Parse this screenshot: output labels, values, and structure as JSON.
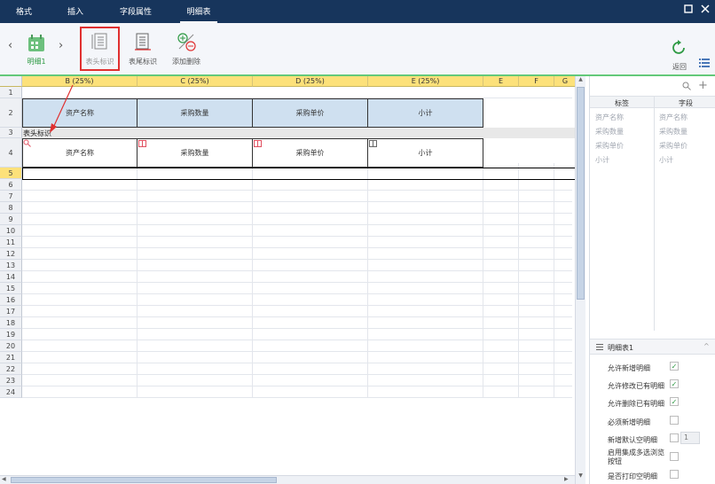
{
  "menu": {
    "tabs": [
      {
        "label": "格式",
        "active": false
      },
      {
        "label": "插入",
        "active": false
      },
      {
        "label": "字段属性",
        "active": false
      },
      {
        "label": "明细表",
        "active": true
      }
    ]
  },
  "ribbon": {
    "detail_item": "明细1",
    "buttons": [
      {
        "label": "表头标识",
        "highlighted": true
      },
      {
        "label": "表尾标识",
        "highlighted": false
      },
      {
        "label": "添加删除",
        "highlighted": false
      }
    ],
    "back_label": "返回"
  },
  "sheet": {
    "columns": [
      "B (25%)",
      "C (25%)",
      "D (25%)",
      "E (25%)",
      "E",
      "F",
      "G"
    ],
    "rows": [
      "1",
      "2",
      "3",
      "4",
      "5",
      "6",
      "7",
      "8",
      "9",
      "10",
      "11",
      "12",
      "13",
      "14",
      "15",
      "16",
      "17",
      "18",
      "19",
      "20",
      "21",
      "22",
      "23",
      "24"
    ],
    "header_cells": [
      "资产名称",
      "采购数量",
      "采购单价",
      "小计"
    ],
    "band_label": "表头标识",
    "detail_cells": [
      "资产名称",
      "采购数量",
      "采购单价",
      "小计"
    ]
  },
  "fields_panel": {
    "col_label": "标签",
    "col_field": "字段",
    "rows": [
      {
        "label": "资产名称",
        "field": "资产名称"
      },
      {
        "label": "采购数量",
        "field": "采购数量"
      },
      {
        "label": "采购单价",
        "field": "采购单价"
      },
      {
        "label": "小计",
        "field": "小计"
      }
    ]
  },
  "detail_props": {
    "title": "明细表1",
    "options": [
      {
        "label": "允许新增明细",
        "checked": true
      },
      {
        "label": "允许修改已有明细",
        "checked": true
      },
      {
        "label": "允许删除已有明细",
        "checked": true
      },
      {
        "label": "必须新增明细",
        "checked": false
      },
      {
        "label": "新增默认空明细",
        "checked": false,
        "value": "1"
      },
      {
        "label": "启用集成多选浏览按钮",
        "checked": false
      },
      {
        "label": "是否打印空明细",
        "checked": false
      }
    ]
  },
  "colors": {
    "topbar": "#17355c",
    "col_header": "#fce17a",
    "header_cell": "#cfe0f0",
    "accent_green": "#2e9a44",
    "highlight_red": "#e03030"
  }
}
